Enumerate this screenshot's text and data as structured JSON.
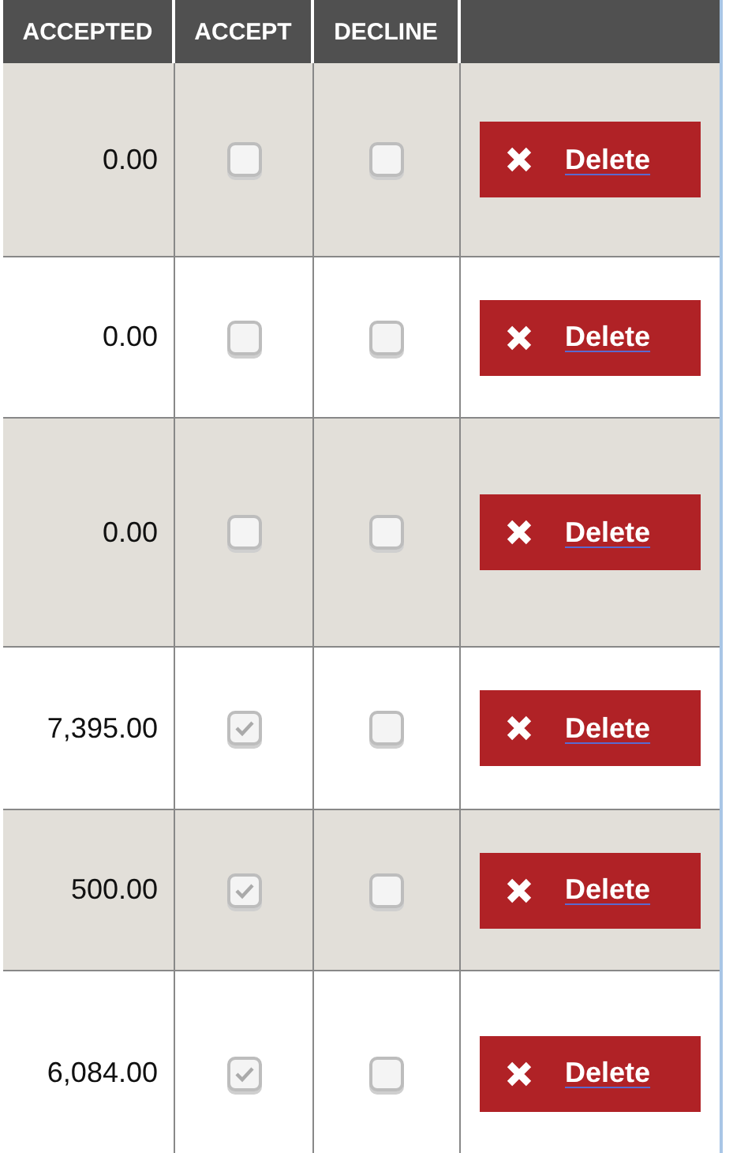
{
  "table": {
    "columns": [
      "ACCEPTED",
      "ACCEPT",
      "DECLINE"
    ],
    "rows": [
      {
        "accepted": "0.00",
        "accept": false,
        "decline": false,
        "action": "Delete"
      },
      {
        "accepted": "0.00",
        "accept": false,
        "decline": false,
        "action": "Delete"
      },
      {
        "accepted": "0.00",
        "accept": false,
        "decline": false,
        "action": "Delete"
      },
      {
        "accepted": "7,395.00",
        "accept": true,
        "decline": false,
        "action": "Delete"
      },
      {
        "accepted": "500.00",
        "accept": true,
        "decline": false,
        "action": "Delete"
      },
      {
        "accepted": "6,084.00",
        "accept": true,
        "decline": false,
        "action": "Delete"
      }
    ]
  }
}
